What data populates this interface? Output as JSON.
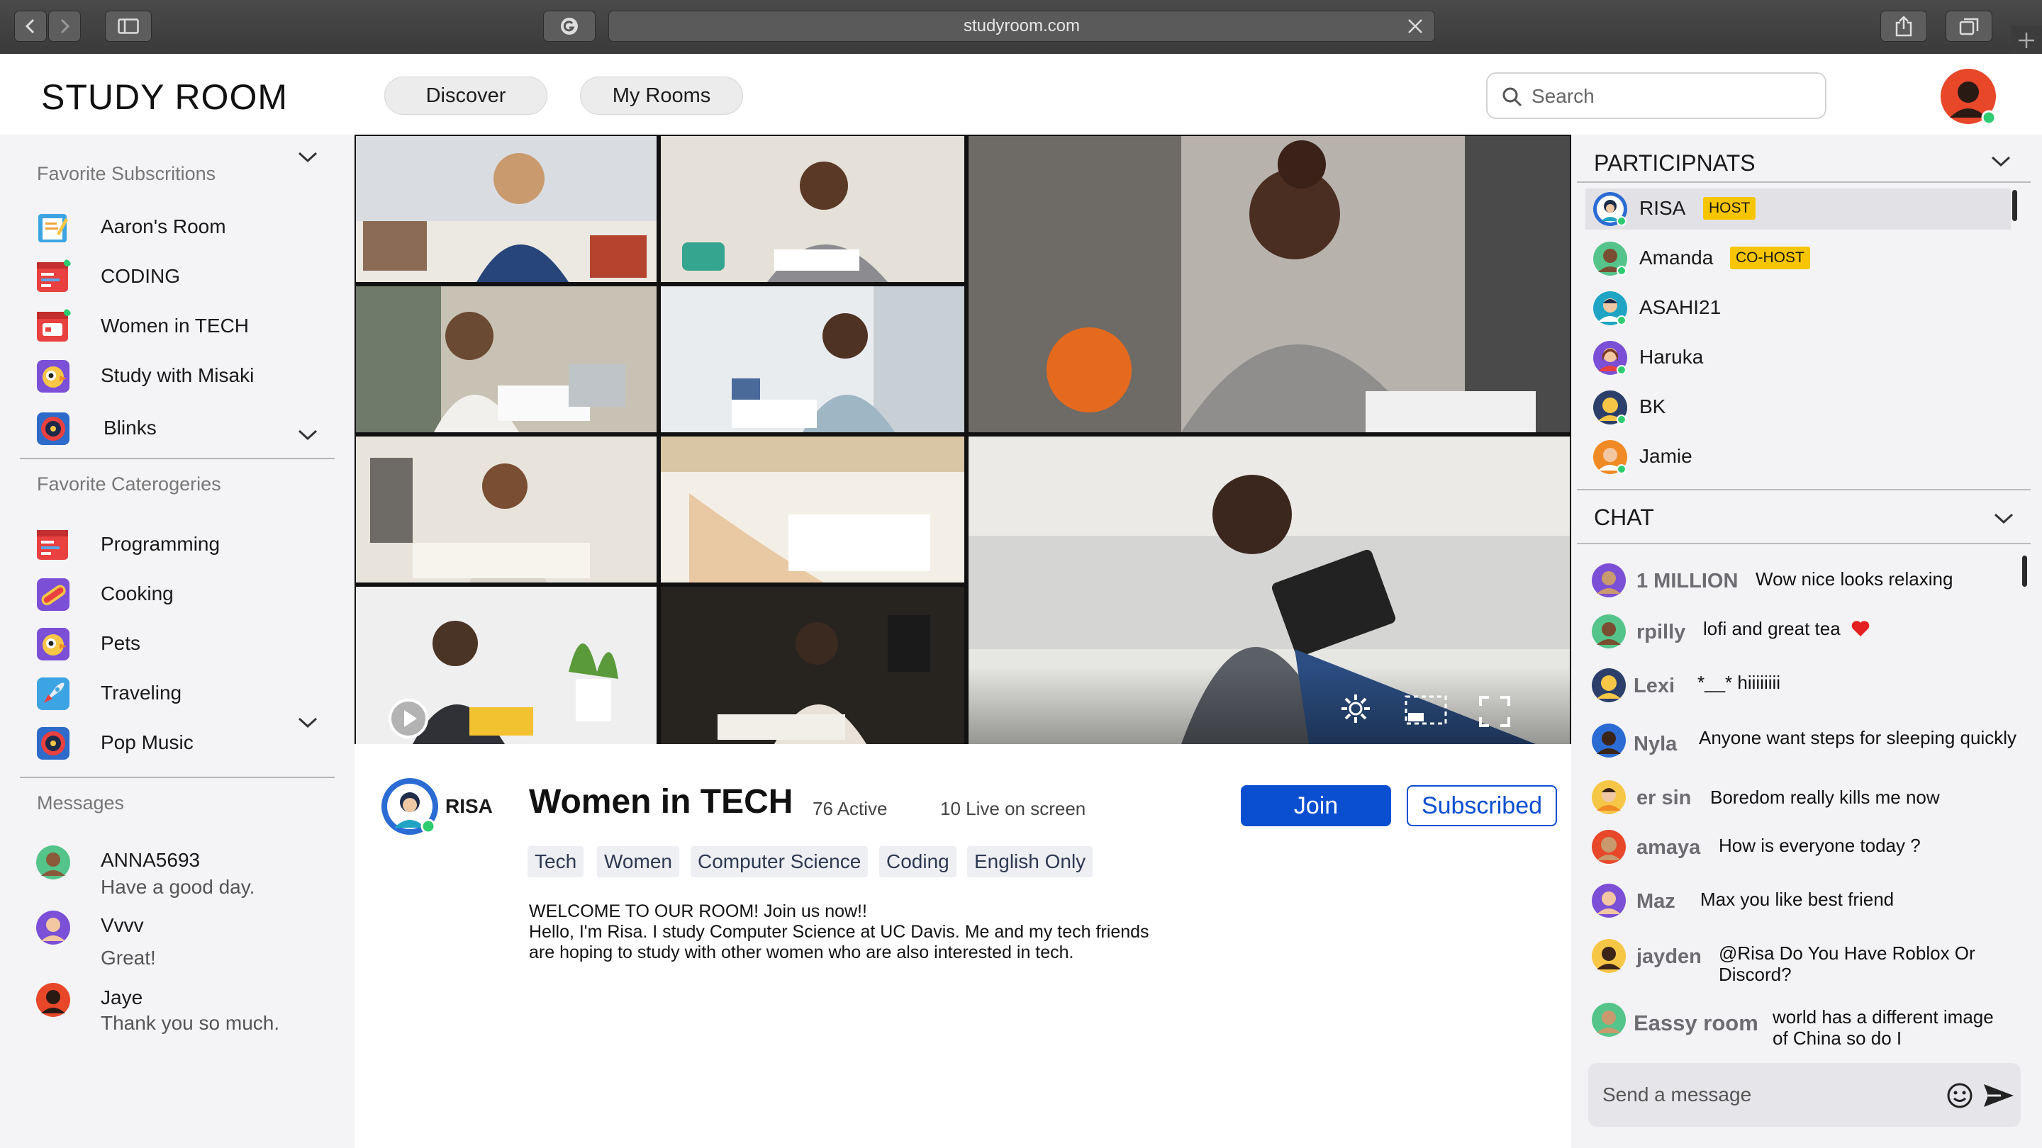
{
  "browser": {
    "url": "studyroom.com"
  },
  "app": {
    "title": "STUDY ROOM"
  },
  "nav": {
    "tabs": [
      {
        "label": "Discover"
      },
      {
        "label": "My Rooms"
      }
    ]
  },
  "search": {
    "placeholder": "Search"
  },
  "sidebar": {
    "favorite_subscriptions_title": "Favorite Subscritions",
    "subscriptions": [
      {
        "label": "Aaron's Room",
        "icon": "notepad-icon"
      },
      {
        "label": "CODING",
        "icon": "code-window-icon"
      },
      {
        "label": "Women in TECH",
        "icon": "calendar-window-icon"
      },
      {
        "label": "Study with Misaki",
        "icon": "bird-icon"
      },
      {
        "label": "Blinks",
        "icon": "vinyl-icon"
      }
    ],
    "favorite_categories_title": "Favorite Caterogeries",
    "categories": [
      {
        "label": "Programming",
        "icon": "code-window-icon"
      },
      {
        "label": "Cooking",
        "icon": "hotdog-icon"
      },
      {
        "label": "Pets",
        "icon": "bird-icon"
      },
      {
        "label": "Traveling",
        "icon": "rocket-icon"
      },
      {
        "label": "Pop Music",
        "icon": "vinyl-icon"
      }
    ],
    "messages_title": "Messages",
    "messages": [
      {
        "name": "ANNA5693",
        "text": "Have a good day."
      },
      {
        "name": "Vvvv",
        "text": "Great!"
      },
      {
        "name": "Jaye",
        "text": "Thank you so much."
      }
    ]
  },
  "room": {
    "host": "RISA",
    "title": "Women in TECH",
    "active": "76 Active",
    "live": "10 Live on screen",
    "join_label": "Join",
    "subscribed_label": "Subscribed",
    "tags": [
      "Tech",
      "Women",
      "Computer Science",
      "Coding",
      "English Only"
    ],
    "description": [
      "WELCOME TO OUR ROOM! Join us now!!",
      "Hello, I'm Risa. I study Computer Science at UC Davis. Me and my tech friends",
      "are hoping to study with other women who are also interested in tech."
    ]
  },
  "participants": {
    "title": "PARTICIPNATS",
    "list": [
      {
        "name": "RISA",
        "role": "HOST"
      },
      {
        "name": "Amanda",
        "role": "CO-HOST"
      },
      {
        "name": "ASAHI21",
        "role": ""
      },
      {
        "name": "Haruka",
        "role": ""
      },
      {
        "name": "BK",
        "role": ""
      },
      {
        "name": "Jamie",
        "role": ""
      }
    ]
  },
  "chat": {
    "title": "CHAT",
    "messages": [
      {
        "name": "1 MILLION",
        "text": "Wow nice looks relaxing"
      },
      {
        "name": "rpilly",
        "text": "lofi and great tea"
      },
      {
        "name": "Lexi",
        "text": "*__* hiiiiiiii"
      },
      {
        "name": "Nyla",
        "text": "Anyone want steps for sleeping quickly"
      },
      {
        "name": "er sin",
        "text": "Boredom really kills me now"
      },
      {
        "name": "amaya",
        "text": "How is everyone today ?"
      },
      {
        "name": "Maz",
        "text": "Max you like best friend"
      },
      {
        "name": "jayden",
        "text": "@Risa Do You Have Roblox Or",
        "text2": "Discord?"
      },
      {
        "name": "Eassy room",
        "text": "world has a different image",
        "text2": "of China so do I"
      }
    ],
    "send_placeholder": "Send a message"
  },
  "colors": {
    "accent": "#0b4fd1",
    "role_badge": "#f7c500",
    "online": "#2ecc71"
  }
}
